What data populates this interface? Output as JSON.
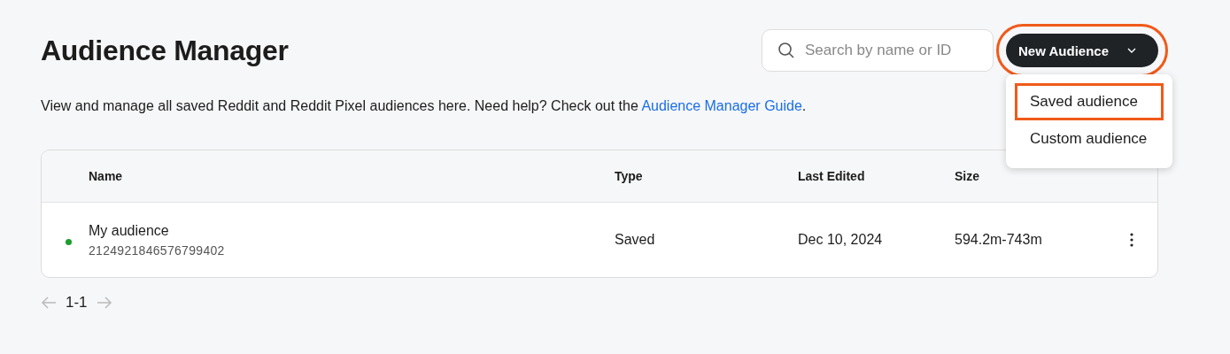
{
  "title": "Audience Manager",
  "search": {
    "placeholder": "Search by name or ID"
  },
  "new_button": {
    "label": "New Audience",
    "highlighted": true,
    "expanded": true
  },
  "menu": [
    {
      "label": "Saved audience",
      "highlighted": true
    },
    {
      "label": "Custom audience",
      "highlighted": false
    }
  ],
  "description": {
    "text": "View and manage all saved Reddit and Reddit Pixel audiences here. Need help? Check out the ",
    "link": "Audience Manager Guide",
    "after": "."
  },
  "table": {
    "columns": [
      "Name",
      "Type",
      "Last Edited",
      "Size"
    ],
    "rows": [
      {
        "name": "My audience",
        "id": "2124921846576799402",
        "color": "#1a9e2c",
        "type": "Saved",
        "last_edited": "Dec 10, 2024",
        "size": "594.2m-743m"
      }
    ]
  },
  "pagination": {
    "range": "1-1"
  }
}
